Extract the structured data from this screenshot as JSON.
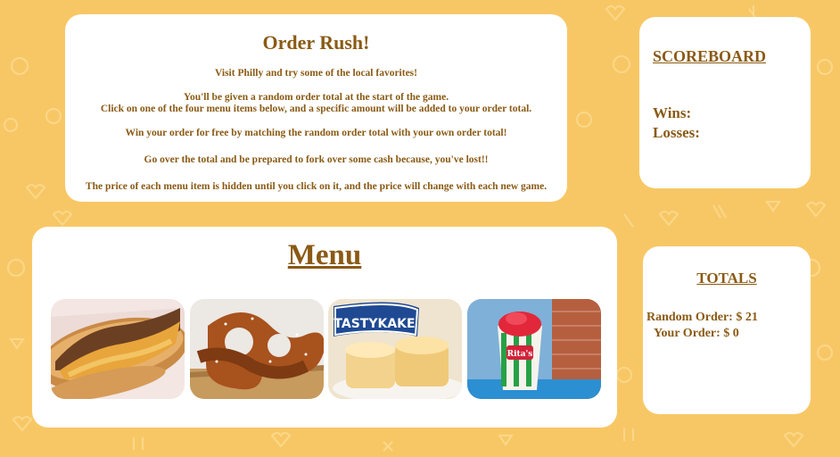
{
  "intro": {
    "title": "Order Rush!",
    "line1": "Visit Philly and try some of the local favorites!",
    "line2": "You'll be given a random order total at the start of the game.",
    "line3": "Click on one of the four menu items below, and a specific amount will be added to your order total.",
    "line4": "Win your order for free by matching the random order total with your own order total!",
    "line5": "Go over the total and be prepared to fork over some cash because, you've lost!!",
    "line6": "The price of each menu item is hidden until you click on it, and the price will change with each new game."
  },
  "scoreboard": {
    "title": "SCOREBOARD",
    "wins_label": "Wins:",
    "losses_label": "Losses:"
  },
  "menu": {
    "title": "Menu",
    "items": [
      {
        "name": "cheesesteak",
        "icon": "cheesesteak-image"
      },
      {
        "name": "soft pretzel",
        "icon": "pretzel-image"
      },
      {
        "name": "tastykake",
        "icon": "tastykake-image",
        "brand_text": "TASTYKAKE"
      },
      {
        "name": "water ice",
        "icon": "water-ice-image",
        "brand_text": "Rita's"
      }
    ]
  },
  "totals": {
    "title": "TOTALS",
    "random_order": "Random Order: $ 21",
    "your_order": "Your Order: $ 0"
  },
  "colors": {
    "background": "#f8c765",
    "text": "#8a5a14",
    "card": "#ffffff"
  }
}
